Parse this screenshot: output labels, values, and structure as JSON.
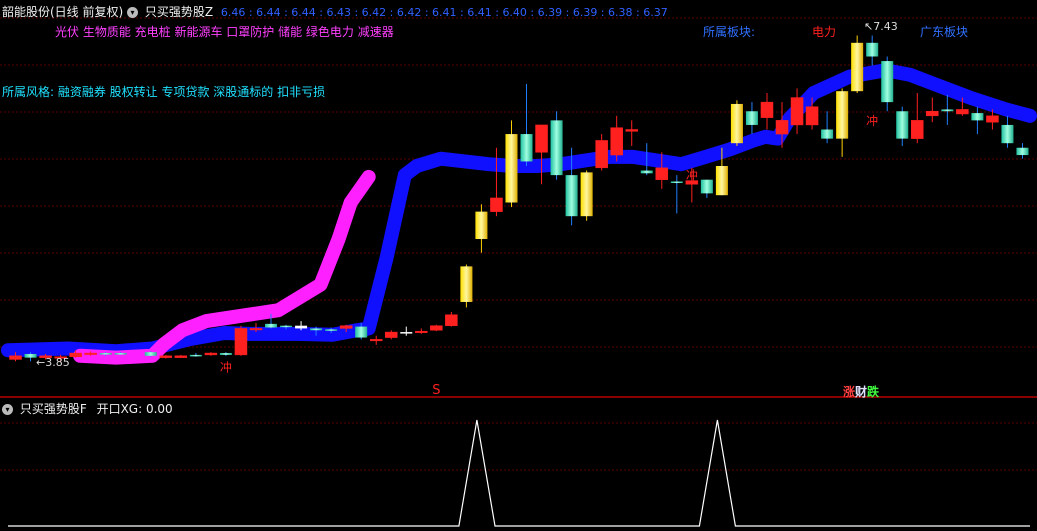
{
  "header": {
    "title": "韶能股份(日线 前复权)",
    "indicator_name": "只买强势股Z",
    "values": [
      "6.46",
      "6.44",
      "6.44",
      "6.43",
      "6.42",
      "6.42",
      "6.41",
      "6.41",
      "6.40",
      "6.39",
      "6.39",
      "6.38",
      "6.37"
    ]
  },
  "concepts_line": "光伏 生物质能 充电桩 新能源车 口罩防护 储能 绿色电力 减速器",
  "style_line": "所属风格: 融资融券 股权转让 专项贷款 深股通标的 扣非亏损",
  "sector": {
    "label": "所属板块:",
    "value1": "电力",
    "value2": "广东板块"
  },
  "price_labels": {
    "high": "7.43",
    "low": "3.85"
  },
  "markers": {
    "chong": "冲",
    "s": "S",
    "zhang": "涨",
    "cai": "财",
    "die": "跌"
  },
  "sub": {
    "indicator_name": "只买强势股F",
    "label": "开口XG:",
    "value": "0.00"
  },
  "colors": {
    "up": "#ff2020",
    "down": "#40e0c0",
    "strong": "#ffd000",
    "band_blue": "#1010ff",
    "band_magenta": "#ff20ff",
    "grid": "#5a0000",
    "header_values": "#3060ff",
    "concepts": "#ff40ff",
    "style": "#20e0ff"
  },
  "chart_data": {
    "type": "candlestick",
    "ylim": [
      3.6,
      7.6
    ],
    "candles": [
      {
        "o": 3.92,
        "h": 3.96,
        "l": 3.86,
        "c": 3.88,
        "k": "r"
      },
      {
        "o": 3.9,
        "h": 3.96,
        "l": 3.86,
        "c": 3.94,
        "k": "g"
      },
      {
        "o": 3.92,
        "h": 3.94,
        "l": 3.88,
        "c": 3.9,
        "k": "r"
      },
      {
        "o": 3.9,
        "h": 3.93,
        "l": 3.86,
        "c": 3.91,
        "k": "r"
      },
      {
        "o": 3.91,
        "h": 3.98,
        "l": 3.9,
        "c": 3.95,
        "k": "r"
      },
      {
        "o": 3.95,
        "h": 3.97,
        "l": 3.92,
        "c": 3.94,
        "k": "r"
      },
      {
        "o": 3.94,
        "h": 3.96,
        "l": 3.92,
        "c": 3.95,
        "k": "g"
      },
      {
        "o": 3.95,
        "h": 3.96,
        "l": 3.93,
        "c": 3.94,
        "k": "g"
      },
      {
        "o": 3.94,
        "h": 3.97,
        "l": 3.93,
        "c": 3.96,
        "k": "p"
      },
      {
        "o": 3.96,
        "h": 3.97,
        "l": 3.91,
        "c": 3.92,
        "k": "g"
      },
      {
        "o": 3.92,
        "h": 3.93,
        "l": 3.89,
        "c": 3.9,
        "k": "r"
      },
      {
        "o": 3.9,
        "h": 3.93,
        "l": 3.9,
        "c": 3.92,
        "k": "r"
      },
      {
        "o": 3.92,
        "h": 3.95,
        "l": 3.91,
        "c": 3.93,
        "k": "g"
      },
      {
        "o": 3.93,
        "h": 3.96,
        "l": 3.92,
        "c": 3.95,
        "k": "r"
      },
      {
        "o": 3.95,
        "h": 3.96,
        "l": 3.92,
        "c": 3.93,
        "k": "g"
      },
      {
        "o": 3.93,
        "h": 4.25,
        "l": 3.92,
        "c": 4.22,
        "k": "r"
      },
      {
        "o": 4.22,
        "h": 4.28,
        "l": 4.18,
        "c": 4.22,
        "k": "r"
      },
      {
        "o": 4.23,
        "h": 4.38,
        "l": 4.22,
        "c": 4.27,
        "k": "g"
      },
      {
        "o": 4.24,
        "h": 4.26,
        "l": 4.21,
        "c": 4.25,
        "k": "g"
      },
      {
        "o": 4.25,
        "h": 4.3,
        "l": 4.2,
        "c": 4.22,
        "k": "w"
      },
      {
        "o": 4.22,
        "h": 4.24,
        "l": 4.14,
        "c": 4.2,
        "k": "g"
      },
      {
        "o": 4.2,
        "h": 4.23,
        "l": 4.17,
        "c": 4.21,
        "k": "g"
      },
      {
        "o": 4.22,
        "h": 4.26,
        "l": 4.18,
        "c": 4.25,
        "k": "r"
      },
      {
        "o": 4.24,
        "h": 4.28,
        "l": 4.1,
        "c": 4.12,
        "k": "g"
      },
      {
        "o": 4.1,
        "h": 4.14,
        "l": 4.04,
        "c": 4.09,
        "k": "r"
      },
      {
        "o": 4.12,
        "h": 4.2,
        "l": 4.1,
        "c": 4.18,
        "k": "r"
      },
      {
        "o": 4.18,
        "h": 4.24,
        "l": 4.14,
        "c": 4.17,
        "k": "w"
      },
      {
        "o": 4.18,
        "h": 4.22,
        "l": 4.16,
        "c": 4.19,
        "k": "r"
      },
      {
        "o": 4.2,
        "h": 4.26,
        "l": 4.19,
        "c": 4.25,
        "k": "r"
      },
      {
        "o": 4.25,
        "h": 4.4,
        "l": 4.24,
        "c": 4.37,
        "k": "r"
      },
      {
        "o": 4.51,
        "h": 4.92,
        "l": 4.45,
        "c": 4.9,
        "k": "y"
      },
      {
        "o": 5.2,
        "h": 5.58,
        "l": 5.05,
        "c": 5.5,
        "k": "y"
      },
      {
        "o": 5.5,
        "h": 6.2,
        "l": 5.45,
        "c": 5.65,
        "k": "r"
      },
      {
        "o": 5.6,
        "h": 6.5,
        "l": 5.55,
        "c": 6.35,
        "k": "y"
      },
      {
        "o": 6.35,
        "h": 6.9,
        "l": 6.0,
        "c": 6.05,
        "k": "g"
      },
      {
        "o": 6.15,
        "h": 6.4,
        "l": 5.8,
        "c": 6.45,
        "k": "r"
      },
      {
        "o": 6.5,
        "h": 6.6,
        "l": 5.85,
        "c": 5.9,
        "k": "g"
      },
      {
        "o": 5.9,
        "h": 6.2,
        "l": 5.35,
        "c": 5.45,
        "k": "g"
      },
      {
        "o": 5.45,
        "h": 5.95,
        "l": 5.4,
        "c": 5.93,
        "k": "y"
      },
      {
        "o": 5.98,
        "h": 6.35,
        "l": 5.95,
        "c": 6.28,
        "k": "r"
      },
      {
        "o": 6.12,
        "h": 6.55,
        "l": 6.05,
        "c": 6.42,
        "k": "r"
      },
      {
        "o": 6.4,
        "h": 6.5,
        "l": 6.22,
        "c": 6.38,
        "k": "r"
      },
      {
        "o": 5.95,
        "h": 6.25,
        "l": 5.9,
        "c": 5.92,
        "k": "g"
      },
      {
        "o": 5.85,
        "h": 6.15,
        "l": 5.75,
        "c": 5.98,
        "k": "r"
      },
      {
        "o": 5.82,
        "h": 5.9,
        "l": 5.48,
        "c": 5.83,
        "k": "g"
      },
      {
        "o": 5.84,
        "h": 5.98,
        "l": 5.6,
        "c": 5.8,
        "k": "r"
      },
      {
        "o": 5.85,
        "h": 5.75,
        "l": 5.65,
        "c": 5.7,
        "k": "g"
      },
      {
        "o": 5.68,
        "h": 6.2,
        "l": 5.68,
        "c": 6.0,
        "k": "y"
      },
      {
        "o": 6.25,
        "h": 6.72,
        "l": 6.22,
        "c": 6.68,
        "k": "y"
      },
      {
        "o": 6.6,
        "h": 6.7,
        "l": 6.35,
        "c": 6.45,
        "k": "g"
      },
      {
        "o": 6.53,
        "h": 6.8,
        "l": 6.4,
        "c": 6.7,
        "k": "r"
      },
      {
        "o": 6.35,
        "h": 6.7,
        "l": 6.2,
        "c": 6.5,
        "k": "r"
      },
      {
        "o": 6.45,
        "h": 6.85,
        "l": 6.35,
        "c": 6.75,
        "k": "r"
      },
      {
        "o": 6.65,
        "h": 6.75,
        "l": 6.4,
        "c": 6.45,
        "k": "r"
      },
      {
        "o": 6.4,
        "h": 6.6,
        "l": 6.25,
        "c": 6.3,
        "k": "g"
      },
      {
        "o": 6.3,
        "h": 6.85,
        "l": 6.1,
        "c": 6.82,
        "k": "y"
      },
      {
        "o": 6.82,
        "h": 7.43,
        "l": 6.8,
        "c": 7.35,
        "k": "y"
      },
      {
        "o": 7.2,
        "h": 7.43,
        "l": 7.1,
        "c": 7.35,
        "k": "g"
      },
      {
        "o": 7.15,
        "h": 7.2,
        "l": 6.6,
        "c": 6.7,
        "k": "g"
      },
      {
        "o": 6.6,
        "h": 6.65,
        "l": 6.22,
        "c": 6.3,
        "k": "g"
      },
      {
        "o": 6.3,
        "h": 6.8,
        "l": 6.25,
        "c": 6.5,
        "k": "r"
      },
      {
        "o": 6.55,
        "h": 6.75,
        "l": 6.48,
        "c": 6.6,
        "k": "r"
      },
      {
        "o": 6.62,
        "h": 6.78,
        "l": 6.45,
        "c": 6.6,
        "k": "g"
      },
      {
        "o": 6.62,
        "h": 6.75,
        "l": 6.55,
        "c": 6.57,
        "k": "r"
      },
      {
        "o": 6.58,
        "h": 6.65,
        "l": 6.35,
        "c": 6.5,
        "k": "g"
      },
      {
        "o": 6.55,
        "h": 6.62,
        "l": 6.4,
        "c": 6.48,
        "k": "r"
      },
      {
        "o": 6.45,
        "h": 6.55,
        "l": 6.2,
        "c": 6.25,
        "k": "g"
      },
      {
        "o": 6.2,
        "h": 6.25,
        "l": 6.08,
        "c": 6.12,
        "k": "g"
      }
    ],
    "band_blue": [
      [
        0,
        3.98
      ],
      [
        10,
        4.0
      ],
      [
        18,
        3.97
      ],
      [
        24,
        4.0
      ],
      [
        30,
        4.1
      ],
      [
        36,
        4.17
      ],
      [
        40,
        4.16
      ],
      [
        48,
        4.16
      ],
      [
        54,
        4.15
      ],
      [
        58,
        4.2
      ],
      [
        60,
        4.22
      ],
      [
        63,
        5.0
      ],
      [
        66,
        5.9
      ],
      [
        68,
        6.0
      ],
      [
        72,
        6.08
      ],
      [
        76,
        6.05
      ],
      [
        80,
        6.02
      ],
      [
        84,
        6.0
      ],
      [
        88,
        6.0
      ],
      [
        92,
        6.02
      ],
      [
        96,
        6.06
      ],
      [
        100,
        6.1
      ],
      [
        104,
        6.1
      ],
      [
        108,
        6.06
      ],
      [
        112,
        6.02
      ],
      [
        116,
        6.1
      ],
      [
        120,
        6.18
      ],
      [
        124,
        6.28
      ],
      [
        126,
        6.32
      ],
      [
        128,
        6.3
      ],
      [
        130,
        6.52
      ],
      [
        134,
        6.8
      ],
      [
        140,
        6.98
      ],
      [
        146,
        7.05
      ],
      [
        150,
        7.0
      ],
      [
        154,
        6.9
      ],
      [
        160,
        6.75
      ],
      [
        166,
        6.62
      ],
      [
        170,
        6.55
      ]
    ],
    "band_magenta": [
      [
        12,
        3.92
      ],
      [
        18,
        3.9
      ],
      [
        24,
        3.92
      ],
      [
        26,
        4.05
      ],
      [
        29,
        4.2
      ],
      [
        33,
        4.3
      ],
      [
        45,
        4.42
      ],
      [
        52,
        4.7
      ],
      [
        55,
        5.2
      ],
      [
        57,
        5.6
      ],
      [
        60,
        5.88
      ]
    ],
    "markers": [
      {
        "t": "chong",
        "i": 14,
        "y": 3.75
      },
      {
        "t": "chong",
        "i": 45,
        "y": 5.85
      },
      {
        "t": "chong",
        "i": 57,
        "y": 6.45
      },
      {
        "t": "s",
        "i": 28,
        "y": 3.5
      }
    ]
  },
  "sub_chart": {
    "series": [
      [
        0,
        0
      ],
      [
        75,
        0
      ],
      [
        78,
        1
      ],
      [
        81,
        0
      ],
      [
        115,
        0
      ],
      [
        118,
        1
      ],
      [
        121,
        0
      ],
      [
        170,
        0
      ]
    ]
  }
}
